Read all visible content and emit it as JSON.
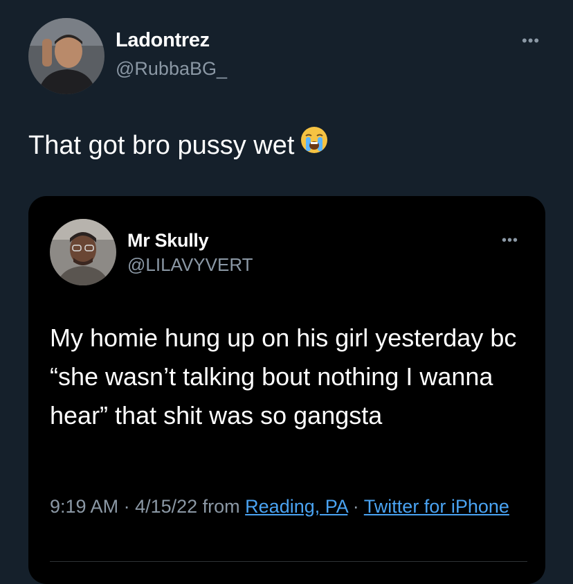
{
  "tweet": {
    "author": {
      "name": "Ladontrez",
      "handle": "@RubbaBG_",
      "avatar_icon": "profile-photo"
    },
    "more_icon": "more-options-icon",
    "text": "That got bro pussy wet",
    "emoji": "loudly-crying-face-emoji"
  },
  "quoted_tweet": {
    "author": {
      "name": "Mr Skully",
      "handle": "@LILAVYVERT",
      "avatar_icon": "profile-photo"
    },
    "more_icon": "more-options-icon",
    "text": "My homie hung up on his girl yesterday bc “she wasn’t talking bout nothing I wanna hear” that shit was so gangsta",
    "meta": {
      "time": "9:19 AM",
      "separator1": " · ",
      "date": "4/15/22",
      "from_label": " from ",
      "location": "Reading, PA",
      "separator2": " · ",
      "source": "Twitter for iPhone"
    }
  },
  "colors": {
    "background": "#15202b",
    "card_background": "#000000",
    "primary_text": "#ffffff",
    "secondary_text": "#8b98a5",
    "link": "#4aa3f2"
  }
}
